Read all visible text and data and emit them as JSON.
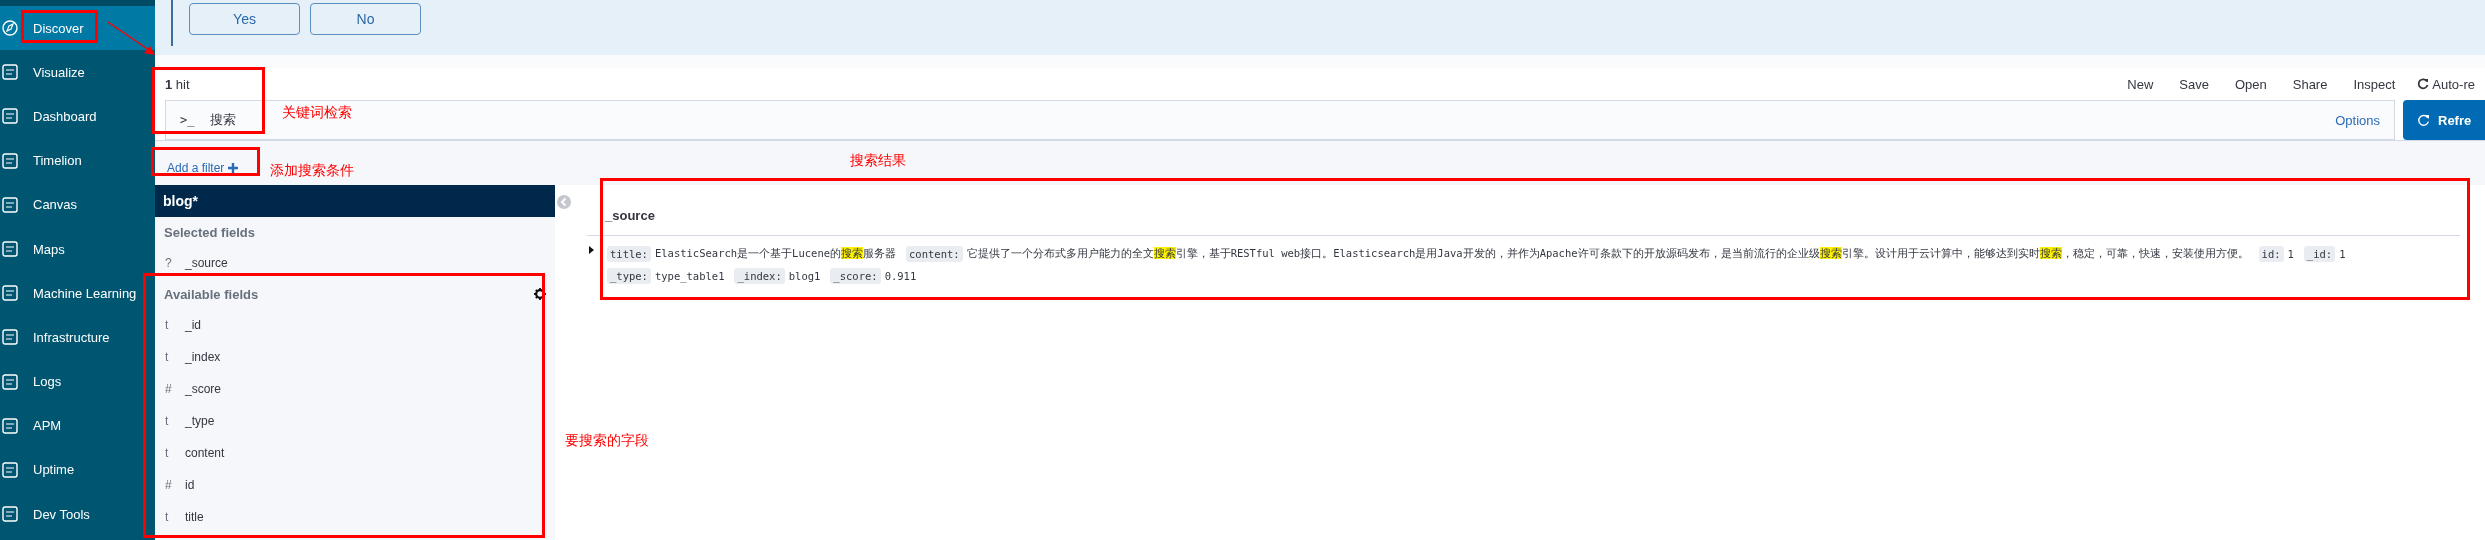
{
  "sidebar": {
    "items": [
      {
        "label": "Discover",
        "selected": true
      },
      {
        "label": "Visualize",
        "selected": false
      },
      {
        "label": "Dashboard",
        "selected": false
      },
      {
        "label": "Timelion",
        "selected": false
      },
      {
        "label": "Canvas",
        "selected": false
      },
      {
        "label": "Maps",
        "selected": false
      },
      {
        "label": "Machine Learning",
        "selected": false
      },
      {
        "label": "Infrastructure",
        "selected": false
      },
      {
        "label": "Logs",
        "selected": false
      },
      {
        "label": "APM",
        "selected": false
      },
      {
        "label": "Uptime",
        "selected": false
      },
      {
        "label": "Dev Tools",
        "selected": false
      }
    ]
  },
  "prompt": {
    "buttons": [
      "Yes",
      "No"
    ]
  },
  "top_nav": {
    "hits": "1",
    "hits_label": "hit",
    "links": [
      "New",
      "Save",
      "Open",
      "Share",
      "Inspect"
    ],
    "auto_refresh": "Auto-re"
  },
  "query_bar": {
    "prompt": ">_",
    "value": "搜索",
    "options": "Options",
    "refresh": "Refre"
  },
  "filter_bar": {
    "add_filter": "Add a filter"
  },
  "field_list": {
    "index_pattern": "blog*",
    "selected_heading": "Selected fields",
    "selected": [
      {
        "type": "?",
        "name": "_source"
      }
    ],
    "available_heading": "Available fields",
    "available": [
      {
        "type": "t",
        "name": "_id"
      },
      {
        "type": "t",
        "name": "_index"
      },
      {
        "type": "#",
        "name": "_score"
      },
      {
        "type": "t",
        "name": "_type"
      },
      {
        "type": "t",
        "name": "content"
      },
      {
        "type": "#",
        "name": "id"
      },
      {
        "type": "t",
        "name": "title"
      }
    ]
  },
  "documents": {
    "column": "_source",
    "rows": [
      {
        "expanded": false,
        "lines": [
          [
            {
              "key": "title:",
              "value": [
                {
                  "text": "ElasticSearch是一个基于Lucene的",
                  "highlighted": false
                },
                {
                  "text": "搜索",
                  "highlighted": true
                },
                {
                  "text": "服务器",
                  "highlighted": false
                }
              ]
            },
            {
              "key": "content:",
              "value": [
                {
                  "text": "它提供了一个分布式多用户能力的全文",
                  "highlighted": false
                },
                {
                  "text": "搜索",
                  "highlighted": true
                },
                {
                  "text": "引擎，基于RESTful web接口。Elasticsearch是用Java开发的，并作为Apache许可条款下的开放源码发布，是当前流行的企业级",
                  "highlighted": false
                },
                {
                  "text": "搜索",
                  "highlighted": true
                },
                {
                  "text": "引擎。设计用于云计算中，能够达到实时",
                  "highlighted": false
                },
                {
                  "text": "搜索",
                  "highlighted": true
                },
                {
                  "text": "，稳定，可靠，快速，安装使用方便。",
                  "highlighted": false
                }
              ]
            },
            {
              "key": "id:",
              "value": [
                {
                  "text": "1",
                  "highlighted": false
                }
              ]
            },
            {
              "key": "_id:",
              "value": [
                {
                  "text": "1",
                  "highlighted": false
                }
              ]
            }
          ],
          [
            {
              "key": "_type:",
              "value": [
                {
                  "text": "type_table1",
                  "highlighted": false
                }
              ]
            },
            {
              "key": "_index:",
              "value": [
                {
                  "text": "blog1",
                  "highlighted": false
                }
              ]
            },
            {
              "key": "_score:",
              "value": [
                {
                  "text": "0.911",
                  "highlighted": false
                }
              ]
            }
          ]
        ]
      }
    ]
  },
  "annotations": [
    {
      "kind": "box"
    },
    {
      "kind": "arrow"
    },
    {
      "kind": "box"
    },
    {
      "kind": "label",
      "text": "关键词检索"
    },
    {
      "kind": "box"
    },
    {
      "kind": "label",
      "text": "添加搜索条件"
    },
    {
      "kind": "label",
      "text": "搜索结果"
    },
    {
      "kind": "box"
    },
    {
      "kind": "box"
    },
    {
      "kind": "label",
      "text": "要搜索的字段"
    }
  ]
}
